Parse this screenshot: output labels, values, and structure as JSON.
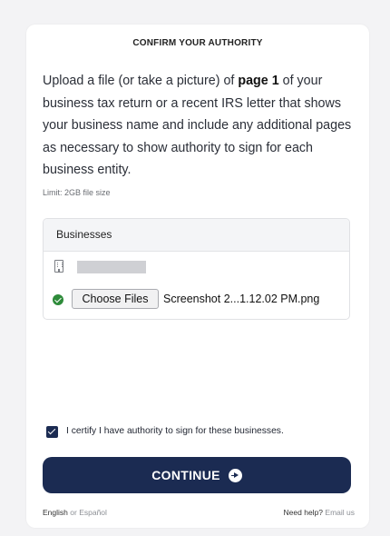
{
  "card": {
    "heading": "CONFIRM YOUR AUTHORITY",
    "instructions": {
      "before": "Upload a file (or take a picture) of ",
      "bold": "page 1",
      "after": " of your business tax return or a recent IRS letter that shows your business name and include any additional pages as necessary to show authority to sign for each business entity."
    },
    "limit": "Limit: 2GB file size"
  },
  "businesses": {
    "header": "Businesses",
    "rows": [
      {
        "icon": "building-icon",
        "name_redacted": true
      },
      {
        "status_icon": "check-circle-icon",
        "choose_label": "Choose Files",
        "file_name": "Screenshot 2...1.12.02 PM.png"
      }
    ]
  },
  "certify": {
    "checked": true,
    "label": "I certify I have authority to sign for these businesses."
  },
  "continue": {
    "label": "CONTINUE",
    "icon": "arrow-right-circle-icon"
  },
  "footer": {
    "lang_current": "English",
    "lang_or": "or",
    "lang_alt": "Español",
    "help_text": "Need help?",
    "help_link": "Email us"
  },
  "colors": {
    "primary": "#1b2b52",
    "success": "#2e8b3a",
    "background": "#f3f3f5"
  }
}
